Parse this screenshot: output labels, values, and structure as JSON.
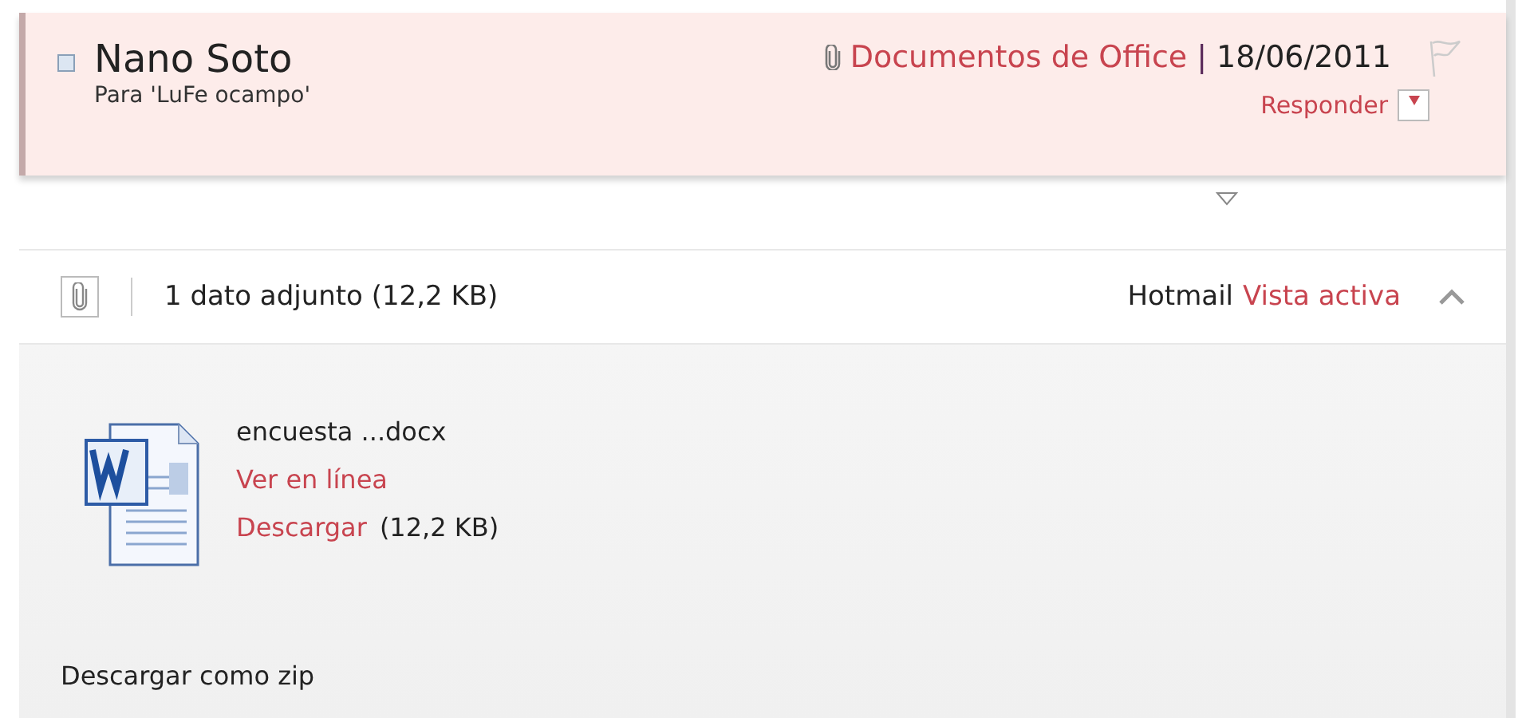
{
  "header": {
    "sender": "Nano Soto",
    "recipient": "Para 'LuFe ocampo'",
    "folder": "Documentos de Office",
    "separator": "|",
    "date": "18/06/2011",
    "reply": "Responder"
  },
  "attachments_bar": {
    "summary": "1 dato adjunto (12,2 KB)",
    "source": "Hotmail",
    "view_link": "Vista activa"
  },
  "attachments": [
    {
      "name": "encuesta ...docx",
      "view": "Ver en línea",
      "download": "Descargar",
      "size": "(12,2 KB)"
    }
  ],
  "zip_link": "Descargar como zip"
}
